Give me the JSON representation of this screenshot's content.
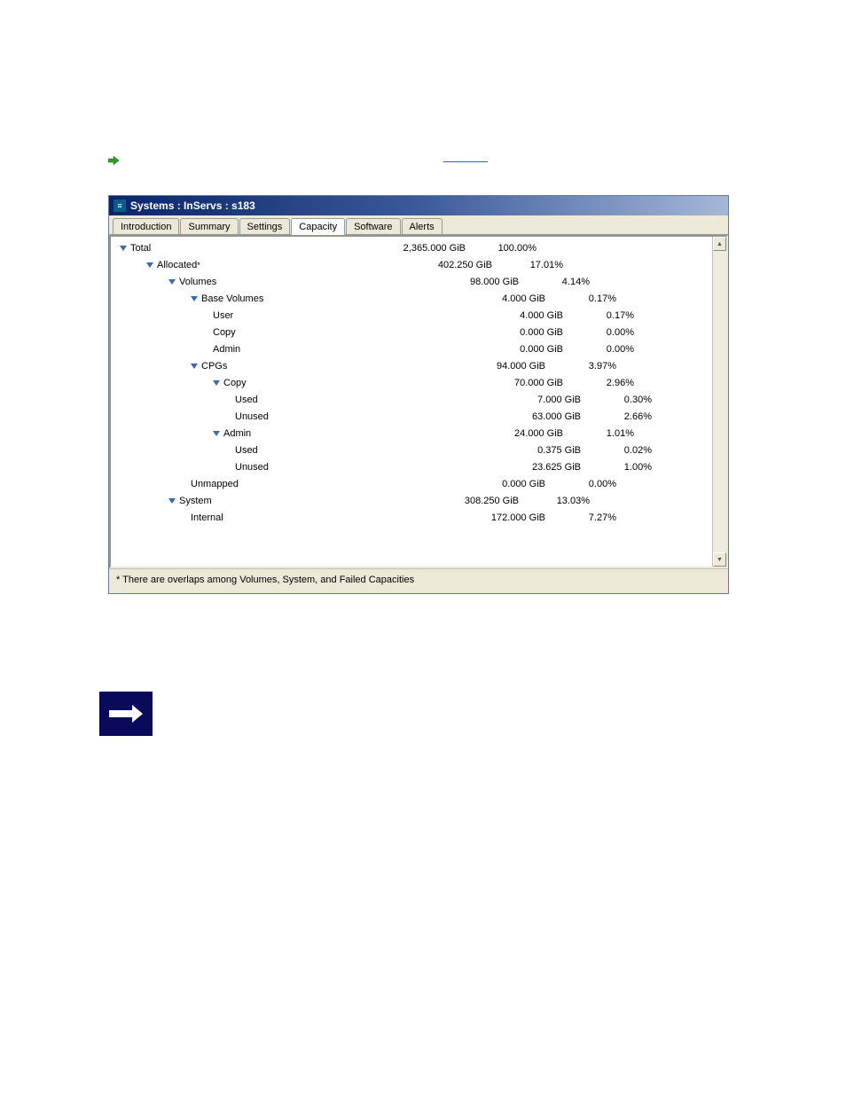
{
  "window": {
    "title": "Systems : InServs : s183",
    "icon_glyph": "≡"
  },
  "tabs": {
    "items": [
      {
        "label": "Introduction"
      },
      {
        "label": "Summary"
      },
      {
        "label": "Settings"
      },
      {
        "label": "Capacity"
      },
      {
        "label": "Software"
      },
      {
        "label": "Alerts"
      }
    ],
    "active_index": 3
  },
  "rows": [
    {
      "indent": 0,
      "expandable": true,
      "label": "Total",
      "size": "2,365.000 GiB",
      "pct": "100.00%"
    },
    {
      "indent": 1,
      "expandable": true,
      "label": "Allocated",
      "sup": "*",
      "size": "402.250 GiB",
      "pct": "17.01%"
    },
    {
      "indent": 2,
      "expandable": true,
      "label": "Volumes",
      "size": "98.000 GiB",
      "pct": "4.14%"
    },
    {
      "indent": 3,
      "expandable": true,
      "label": "Base Volumes",
      "size": "4.000 GiB",
      "pct": "0.17%"
    },
    {
      "indent": 4,
      "expandable": false,
      "label": "User",
      "size": "4.000 GiB",
      "pct": "0.17%"
    },
    {
      "indent": 4,
      "expandable": false,
      "label": "Copy",
      "size": "0.000 GiB",
      "pct": "0.00%"
    },
    {
      "indent": 4,
      "expandable": false,
      "label": "Admin",
      "size": "0.000 GiB",
      "pct": "0.00%"
    },
    {
      "indent": 3,
      "expandable": true,
      "label": "CPGs",
      "size": "94.000 GiB",
      "pct": "3.97%"
    },
    {
      "indent": 4,
      "expandable": true,
      "label": "Copy",
      "size": "70.000 GiB",
      "pct": "2.96%"
    },
    {
      "indent": 5,
      "expandable": false,
      "label": "Used",
      "size": "7.000 GiB",
      "pct": "0.30%"
    },
    {
      "indent": 5,
      "expandable": false,
      "label": "Unused",
      "size": "63.000 GiB",
      "pct": "2.66%"
    },
    {
      "indent": 4,
      "expandable": true,
      "label": "Admin",
      "size": "24.000 GiB",
      "pct": "1.01%"
    },
    {
      "indent": 5,
      "expandable": false,
      "label": "Used",
      "size": "0.375 GiB",
      "pct": "0.02%"
    },
    {
      "indent": 5,
      "expandable": false,
      "label": "Unused",
      "size": "23.625 GiB",
      "pct": "1.00%"
    },
    {
      "indent": 3,
      "expandable": false,
      "label": "Unmapped",
      "size": "0.000 GiB",
      "pct": "0.00%"
    },
    {
      "indent": 2,
      "expandable": true,
      "label": "System",
      "size": "308.250 GiB",
      "pct": "13.03%"
    },
    {
      "indent": 3,
      "expandable": false,
      "label": "Internal",
      "size": "172.000 GiB",
      "pct": "7.27%"
    }
  ],
  "size_offsets": [
    300,
    330,
    360,
    390,
    410,
    430
  ],
  "footnote": "* There are overlaps among Volumes, System, and Failed Capacities",
  "scroll": {
    "up": "▲",
    "down": "▼"
  }
}
